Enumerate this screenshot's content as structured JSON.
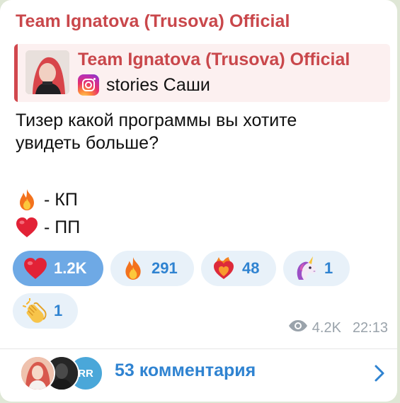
{
  "post": {
    "channel_name": "Team Ignatova (Trusova) Official",
    "reply": {
      "title": "Team Ignatova (Trusova) Official",
      "subtitle": "stories Саши",
      "icon": "instagram-icon"
    },
    "text_line1": "Тизер какой программы вы хотите",
    "text_line2": "увидеть больше?",
    "legend": [
      {
        "icon": "fire-emoji",
        "text": "- КП"
      },
      {
        "icon": "red-heart-emoji",
        "text": "- ПП"
      }
    ],
    "reactions": [
      {
        "icon": "red-heart-emoji",
        "count": "1.2K",
        "active": true
      },
      {
        "icon": "fire-emoji",
        "count": "291",
        "active": false
      },
      {
        "icon": "heart-on-fire-emoji",
        "count": "48",
        "active": false
      },
      {
        "icon": "unicorn-emoji",
        "count": "1",
        "active": false
      },
      {
        "icon": "clapping-hands-emoji",
        "count": "1",
        "active": false
      }
    ],
    "views": "4.2K",
    "time": "22:13"
  },
  "comments": {
    "label": "53 комментария",
    "avatar_initials": "RR"
  },
  "colors": {
    "channel_name": "#c9474b",
    "accent_blue": "#2f83d1",
    "active_reaction": "#6ea9e5",
    "reaction_bg": "#e8f1f9"
  }
}
